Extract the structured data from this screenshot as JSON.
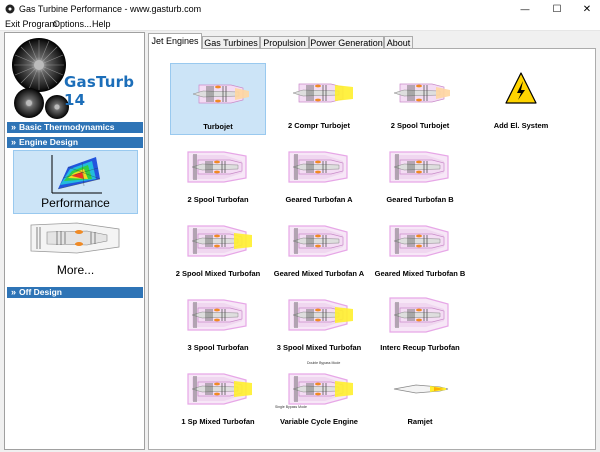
{
  "window": {
    "title": "Gas Turbine Performance - www.gasturb.com",
    "controls": {
      "minimize": "—",
      "maximize": "☐",
      "close": "✕"
    }
  },
  "menu": [
    "Exit Program",
    "Options...",
    "Help"
  ],
  "logo": {
    "text": "GasTurb 14"
  },
  "sidebar": {
    "sections": [
      {
        "label": "Basic Thermodynamics"
      },
      {
        "label": "Engine Design"
      },
      {
        "label": "Off Design"
      }
    ],
    "tiles": [
      {
        "label": "Performance"
      },
      {
        "label": "More..."
      }
    ],
    "section_glyph": "»"
  },
  "tabs": [
    "Jet Engines",
    "Gas Turbines",
    "Propulsion",
    "Power Generation",
    "About"
  ],
  "engines": [
    {
      "label": "Turbojet",
      "icon": "turbojet"
    },
    {
      "label": "2 Compr Turbojet",
      "icon": "turbojet-2-compressor"
    },
    {
      "label": "2 Spool Turbojet",
      "icon": "turbojet-2-spool"
    },
    {
      "label": "Add El. System",
      "icon": "electrical-warning"
    },
    {
      "label": "2 Spool Turbofan",
      "icon": "turbofan"
    },
    {
      "label": "Geared Turbofan A",
      "icon": "geared-turbofan"
    },
    {
      "label": "Geared Turbofan B",
      "icon": "geared-turbofan"
    },
    {
      "label": "2 Spool Mixed Turbofan",
      "icon": "mixed-turbofan"
    },
    {
      "label": "Geared Mixed Turbofan A",
      "icon": "geared-mixed-turbofan"
    },
    {
      "label": "Geared Mixed Turbofan B",
      "icon": "geared-mixed-turbofan"
    },
    {
      "label": "3 Spool Turbofan",
      "icon": "turbofan-3-spool"
    },
    {
      "label": "3 Spool Mixed Turbofan",
      "icon": "mixed-turbofan-3-spool"
    },
    {
      "label": "Interc Recup Turbofan",
      "icon": "intercooled-turbofan"
    },
    {
      "label": "1 Sp Mixed Turbofan",
      "icon": "mixed-turbofan-1-spool"
    },
    {
      "label": "Variable Cycle Engine",
      "icon": "variable-cycle-engine"
    },
    {
      "label": "Ramjet",
      "icon": "ramjet"
    }
  ],
  "vce_annotations": {
    "top": "Double Bypass Mode",
    "bottom": "Single Bypass Mode"
  },
  "colors": {
    "accent": "#2e74b6",
    "selection": "#cce4f7",
    "logo": "#1c6eb9",
    "casing": "#e7a7e7",
    "flame": "#ffef2e"
  }
}
